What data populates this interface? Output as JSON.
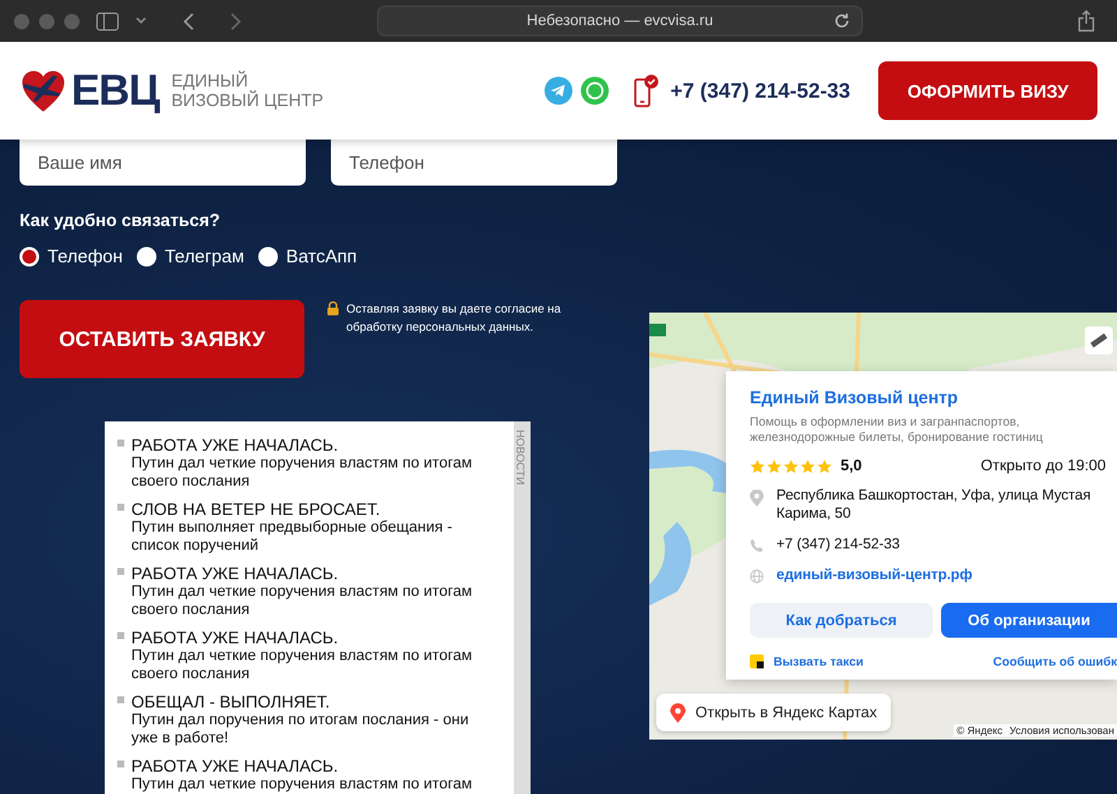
{
  "browser": {
    "address": "Небезопасно — evcvisa.ru"
  },
  "header": {
    "logo_mark": "ЕВЦ",
    "logo_text": [
      "ЕДИНЫЙ",
      "ВИЗОВЫЙ ЦЕНТР"
    ],
    "phone": "+7 (347) 214-52-33",
    "cta": "ОФОРМИТЬ ВИЗУ"
  },
  "form": {
    "fields": [
      {
        "placeholder": "Ваше имя"
      },
      {
        "placeholder": "Телефон"
      }
    ],
    "contact_label": "Как удобно связаться?",
    "contact_options": [
      {
        "label": "Телефон",
        "selected": true
      },
      {
        "label": "Телеграм",
        "selected": false
      },
      {
        "label": "ВатсАпп",
        "selected": false
      }
    ],
    "submit": "ОСТАВИТЬ ЗАЯВКУ",
    "consent": "Оставляя заявку вы даете согласие на обработку персональных данных."
  },
  "news": {
    "tab": "НОВОСТИ",
    "items": [
      {
        "title": "РАБОТА УЖЕ НАЧАЛАСЬ.",
        "text": "Путин дал четкие поручения властям по итогам своего послания"
      },
      {
        "title": "СЛОВ НА ВЕТЕР НЕ БРОСАЕТ.",
        "text": "Путин выполняет предвыборные обещания - список поручений"
      },
      {
        "title": "РАБОТА УЖЕ НАЧАЛАСЬ.",
        "text": "Путин дал четкие поручения властям по итогам своего послания"
      },
      {
        "title": "РАБОТА УЖЕ НАЧАЛАСЬ.",
        "text": "Путин дал четкие поручения властям по итогам своего послания"
      },
      {
        "title": "ОБЕЩАЛ - ВЫПОЛНЯЕТ.",
        "text": "Путин дал поручения по итогам послания - они уже в работе!"
      },
      {
        "title": "РАБОТА УЖЕ НАЧАЛАСЬ.",
        "text": "Путин дал четкие поручения властям по итогам"
      }
    ]
  },
  "map": {
    "card": {
      "title": "Единый Визовый центр",
      "description": "Помощь в оформлении виз и загранпаспортов, железнодорожные билеты, бронирование гостиниц",
      "stars": 5,
      "rating": "5,0",
      "hours": "Открыто до 19:00",
      "address": "Республика Башкортостан, Уфа, улица Мустая Карима, 50",
      "phone": "+7 (347) 214-52-33",
      "website": "единый-визовый-центр.рф",
      "buttons": [
        {
          "label": "Как добраться",
          "kind": "secondary"
        },
        {
          "label": "Об организации",
          "kind": "primary"
        }
      ],
      "taxi": "Вызвать такси",
      "report": "Сообщить об ошибк"
    },
    "open_button": "Открыть в Яндекс Картах",
    "copyright": "© Яндекс",
    "terms": "Условия использован"
  }
}
